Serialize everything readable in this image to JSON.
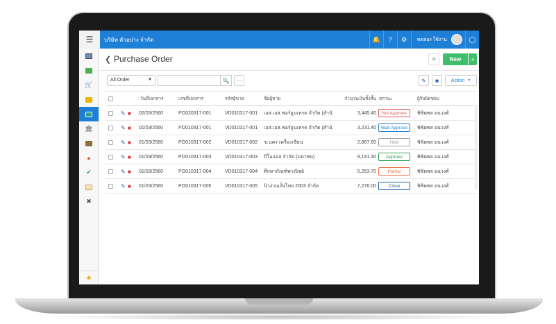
{
  "topbar": {
    "company": "บริษัท ตัวอย่าง จำกัด",
    "user_name": "ทดลอง ใช้งาน",
    "icons": [
      "menu-icon",
      "bell-icon",
      "help-icon",
      "gear-icon",
      "avatar",
      "shield-icon"
    ]
  },
  "sidebar": {
    "items": [
      "image-icon",
      "money-icon",
      "cart-icon",
      "box-icon",
      "document-icon",
      "bank-icon",
      "wallet-icon",
      "badge-icon",
      "check-icon",
      "file-icon",
      "tools-icon"
    ],
    "bottom": "star-icon"
  },
  "page": {
    "title": "Purchase Order",
    "new_label": "New"
  },
  "toolbar": {
    "filter_value": "All Order",
    "search_placeholder": "",
    "action_label": "Action"
  },
  "table": {
    "headers": [
      "วันที่เอกสาร",
      "เลขที่เอกสาร",
      "รหัสผู้ขาย",
      "ชื่อผู้ขาย",
      "จำนวนเงินทั้งสิ้น",
      "สถานะ",
      "ผู้รับผิดชอบ"
    ],
    "rows": [
      {
        "date": "02/03/2560",
        "doc_no": "PO020317-001",
        "vendor_code": "VD010317-001",
        "vendor_name": "เอส.เอส.ฟอร์จูนเทรด จำกัด (สำนั",
        "amount": "3,445.40",
        "status": "Not Approve",
        "owner": "พิชิตพล อนวงศ์"
      },
      {
        "date": "01/03/2560",
        "doc_no": "PO010317-001",
        "vendor_code": "VD010317-001",
        "vendor_name": "เอส.เอส.ฟอร์จูนเทรด จำกัด (สำนั",
        "amount": "3,231.40",
        "status": "Wait Approve",
        "owner": "พิชิตพล อนวงศ์"
      },
      {
        "date": "01/03/2560",
        "doc_no": "PO010317-002",
        "vendor_code": "VD010317-002",
        "vendor_name": "ช.นคร เครื่องเขียน",
        "amount": "2,867.60",
        "status": "Hold",
        "owner": "พิชิตพล อนวงศ์"
      },
      {
        "date": "01/03/2560",
        "doc_no": "PO010317-003",
        "vendor_code": "VD010317-003",
        "vendor_name": "บีโอแอล จำกัด (มหาชน)",
        "amount": "9,191.30",
        "status": "Approve",
        "owner": "พิชิตพล อนวงศ์"
      },
      {
        "date": "01/03/2560",
        "doc_no": "PO010317-004",
        "vendor_code": "VD010317-004",
        "vendor_name": "ศึกษาภัณฑ์พาณิชย์",
        "amount": "5,253.70",
        "status": "Partial",
        "owner": "พิชิตพล อนวงศ์"
      },
      {
        "date": "01/03/2560",
        "doc_no": "PO010317-005",
        "vendor_code": "VD010317-005",
        "vendor_name": "นิวง่วนเส็งไทย 2003 จำกัด",
        "amount": "7,276.00",
        "status": "Close",
        "owner": "พิชิตพล อนวงศ์"
      }
    ]
  },
  "colors": {
    "brand": "#1e7fd6",
    "new_button": "#3fbf6b",
    "not_approve": "#e05555",
    "wait_approve": "#1e7fd6",
    "hold": "#999999",
    "approve": "#2aa052",
    "partial": "#f07040",
    "close": "#1e5fa8"
  }
}
